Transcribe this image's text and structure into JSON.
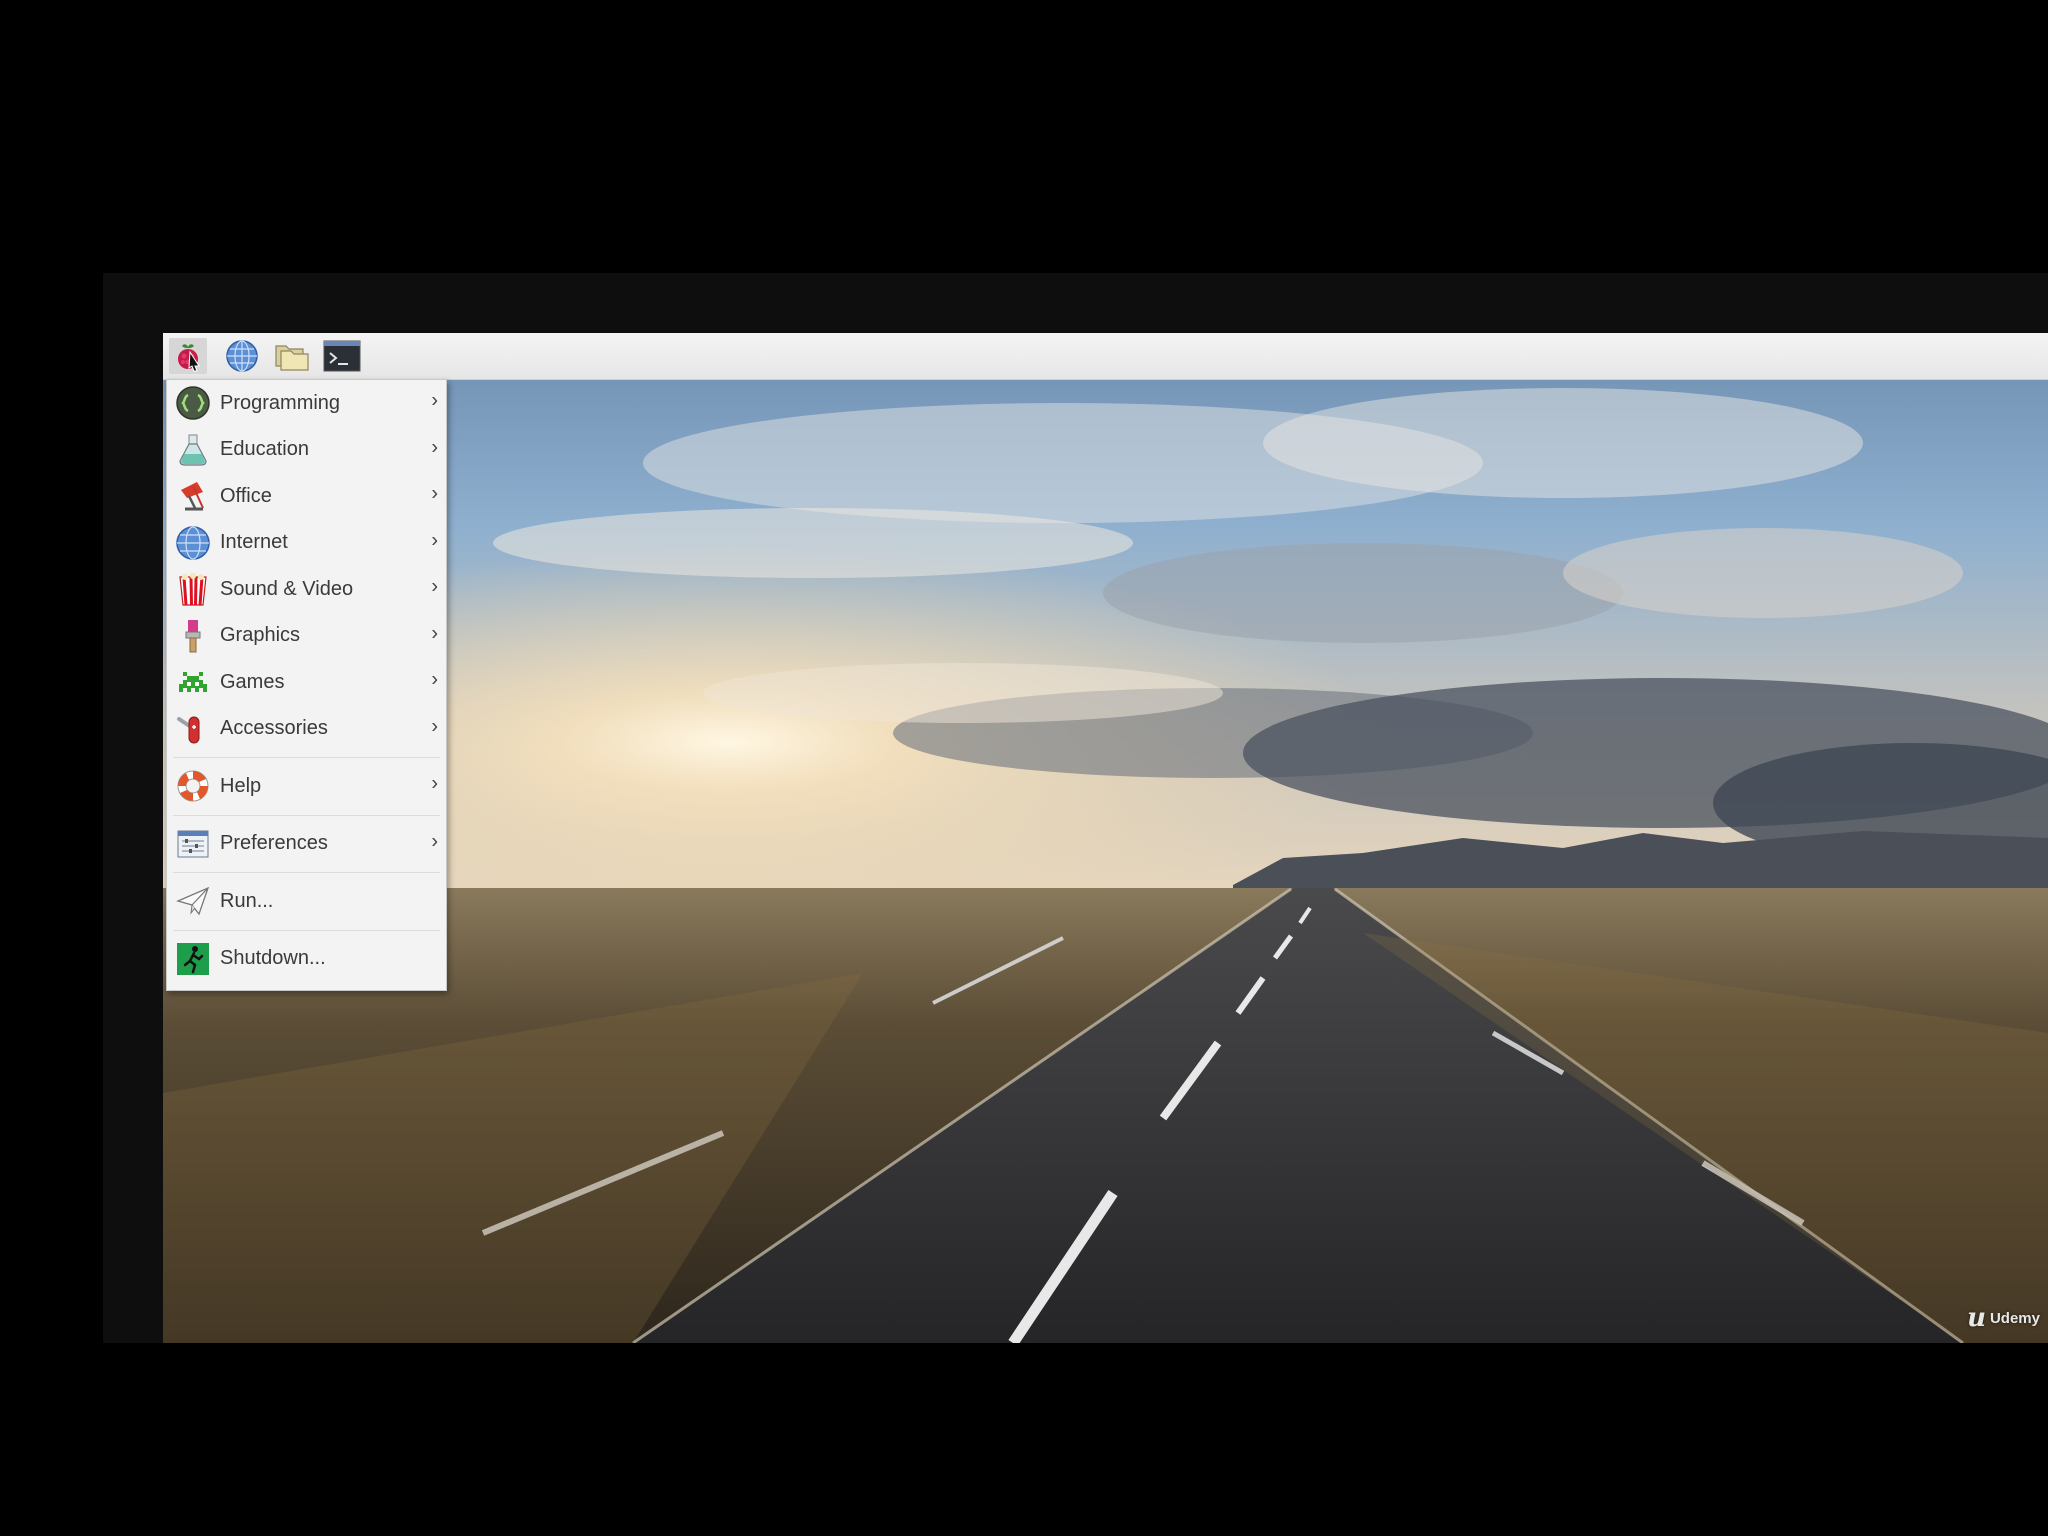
{
  "taskbar": {
    "buttons": [
      {
        "name": "raspberry-menu-button",
        "icon": "raspberry-icon"
      },
      {
        "name": "web-browser-button",
        "icon": "globe-icon"
      },
      {
        "name": "file-manager-button",
        "icon": "folder-icon"
      },
      {
        "name": "terminal-button",
        "icon": "terminal-icon"
      }
    ]
  },
  "menu": {
    "items": [
      {
        "label": "Programming",
        "icon": "programming-icon",
        "submenu": true
      },
      {
        "label": "Education",
        "icon": "flask-icon",
        "submenu": true
      },
      {
        "label": "Office",
        "icon": "office-icon",
        "submenu": true
      },
      {
        "label": "Internet",
        "icon": "globe-icon",
        "submenu": true
      },
      {
        "label": "Sound & Video",
        "icon": "popcorn-icon",
        "submenu": true
      },
      {
        "label": "Graphics",
        "icon": "paintbrush-icon",
        "submenu": true
      },
      {
        "label": "Games",
        "icon": "space-invader-icon",
        "submenu": true
      },
      {
        "label": "Accessories",
        "icon": "pocket-knife-icon",
        "submenu": true
      },
      {
        "label": "Help",
        "icon": "lifebuoy-icon",
        "submenu": true
      },
      {
        "label": "Preferences",
        "icon": "preferences-icon",
        "submenu": true
      },
      {
        "label": "Run...",
        "icon": "paper-plane-icon",
        "submenu": false
      },
      {
        "label": "Shutdown...",
        "icon": "exit-icon",
        "submenu": false
      }
    ],
    "arrow": "›"
  },
  "watermark": {
    "logo": "u",
    "text": "Udemy"
  },
  "colors": {
    "taskbar": "#ececec",
    "menu_bg": "#f3f3f3",
    "menu_text": "#3a3a3a"
  }
}
